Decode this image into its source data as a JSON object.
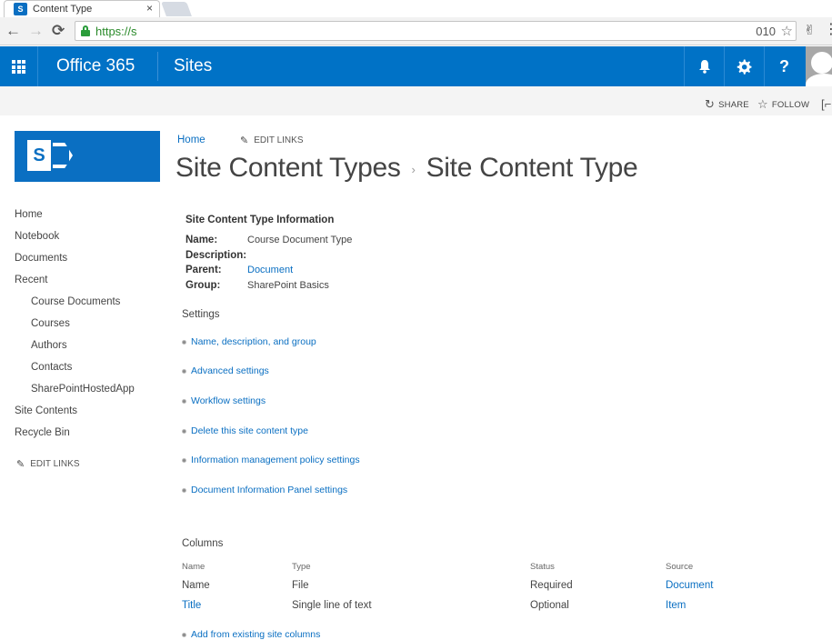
{
  "browser": {
    "tab_title": "Content Type",
    "tab_favicon": "S",
    "url_visible": "https://s",
    "url_tail": "010",
    "icons": {
      "back": "arrow-left-icon",
      "forward": "arrow-right-icon",
      "reload": "reload-icon",
      "lock": "lock-icon",
      "bookmark": "star-icon",
      "extension": "extension-icon",
      "menu": "kebab-menu-icon"
    },
    "glyphs": {
      "close": "×",
      "back": "←",
      "forward": "→",
      "reload": "⟳",
      "star": "☆",
      "extension": "✌",
      "menu": "⋮"
    }
  },
  "suitebar": {
    "brand": "Office 365",
    "app": "Sites",
    "bell_glyph": "🔔",
    "gear_glyph": "⚙",
    "help_glyph": "?",
    "accent": "#0072c6"
  },
  "ribbon": {
    "share_label": "SHARE",
    "follow_label": "FOLLOW",
    "share_glyph": "↻",
    "follow_glyph": "☆",
    "focus_glyph": "[⌐"
  },
  "site": {
    "logo_letter": "S"
  },
  "topnav": {
    "home": "Home",
    "edit_links": "EDIT LINKS",
    "pencil_glyph": "✎"
  },
  "page_title": {
    "parent": "Site Content Types",
    "separator": "›",
    "current": "Site Content Type"
  },
  "leftnav": {
    "items": [
      {
        "label": "Home"
      },
      {
        "label": "Notebook"
      },
      {
        "label": "Documents"
      },
      {
        "label": "Recent"
      },
      {
        "label": "Course Documents"
      },
      {
        "label": "Courses"
      },
      {
        "label": "Authors"
      },
      {
        "label": "Contacts"
      },
      {
        "label": "SharePointHostedApp"
      },
      {
        "label": "Site Contents"
      },
      {
        "label": "Recycle Bin"
      }
    ],
    "edit_links": "EDIT LINKS"
  },
  "info": {
    "title": "Site Content Type Information",
    "name_label": "Name:",
    "name_value": "Course Document Type",
    "description_label": "Description:",
    "description_value": "",
    "parent_label": "Parent:",
    "parent_value": "Document",
    "group_label": "Group:",
    "group_value": "SharePoint Basics"
  },
  "settings": {
    "heading": "Settings",
    "links": [
      "Name, description, and group",
      "Advanced settings",
      "Workflow settings",
      "Delete this site content type",
      "Information management policy settings",
      "Document Information Panel settings"
    ]
  },
  "columns": {
    "heading": "Columns",
    "headers": [
      "Name",
      "Type",
      "Status",
      "Source"
    ],
    "rows": [
      {
        "name": "Name",
        "type": "File",
        "status": "Required",
        "source": "Document"
      },
      {
        "name": "Title",
        "type": "Single line of text",
        "status": "Optional",
        "source": "Item"
      }
    ],
    "add_link": "Add from existing site columns"
  }
}
